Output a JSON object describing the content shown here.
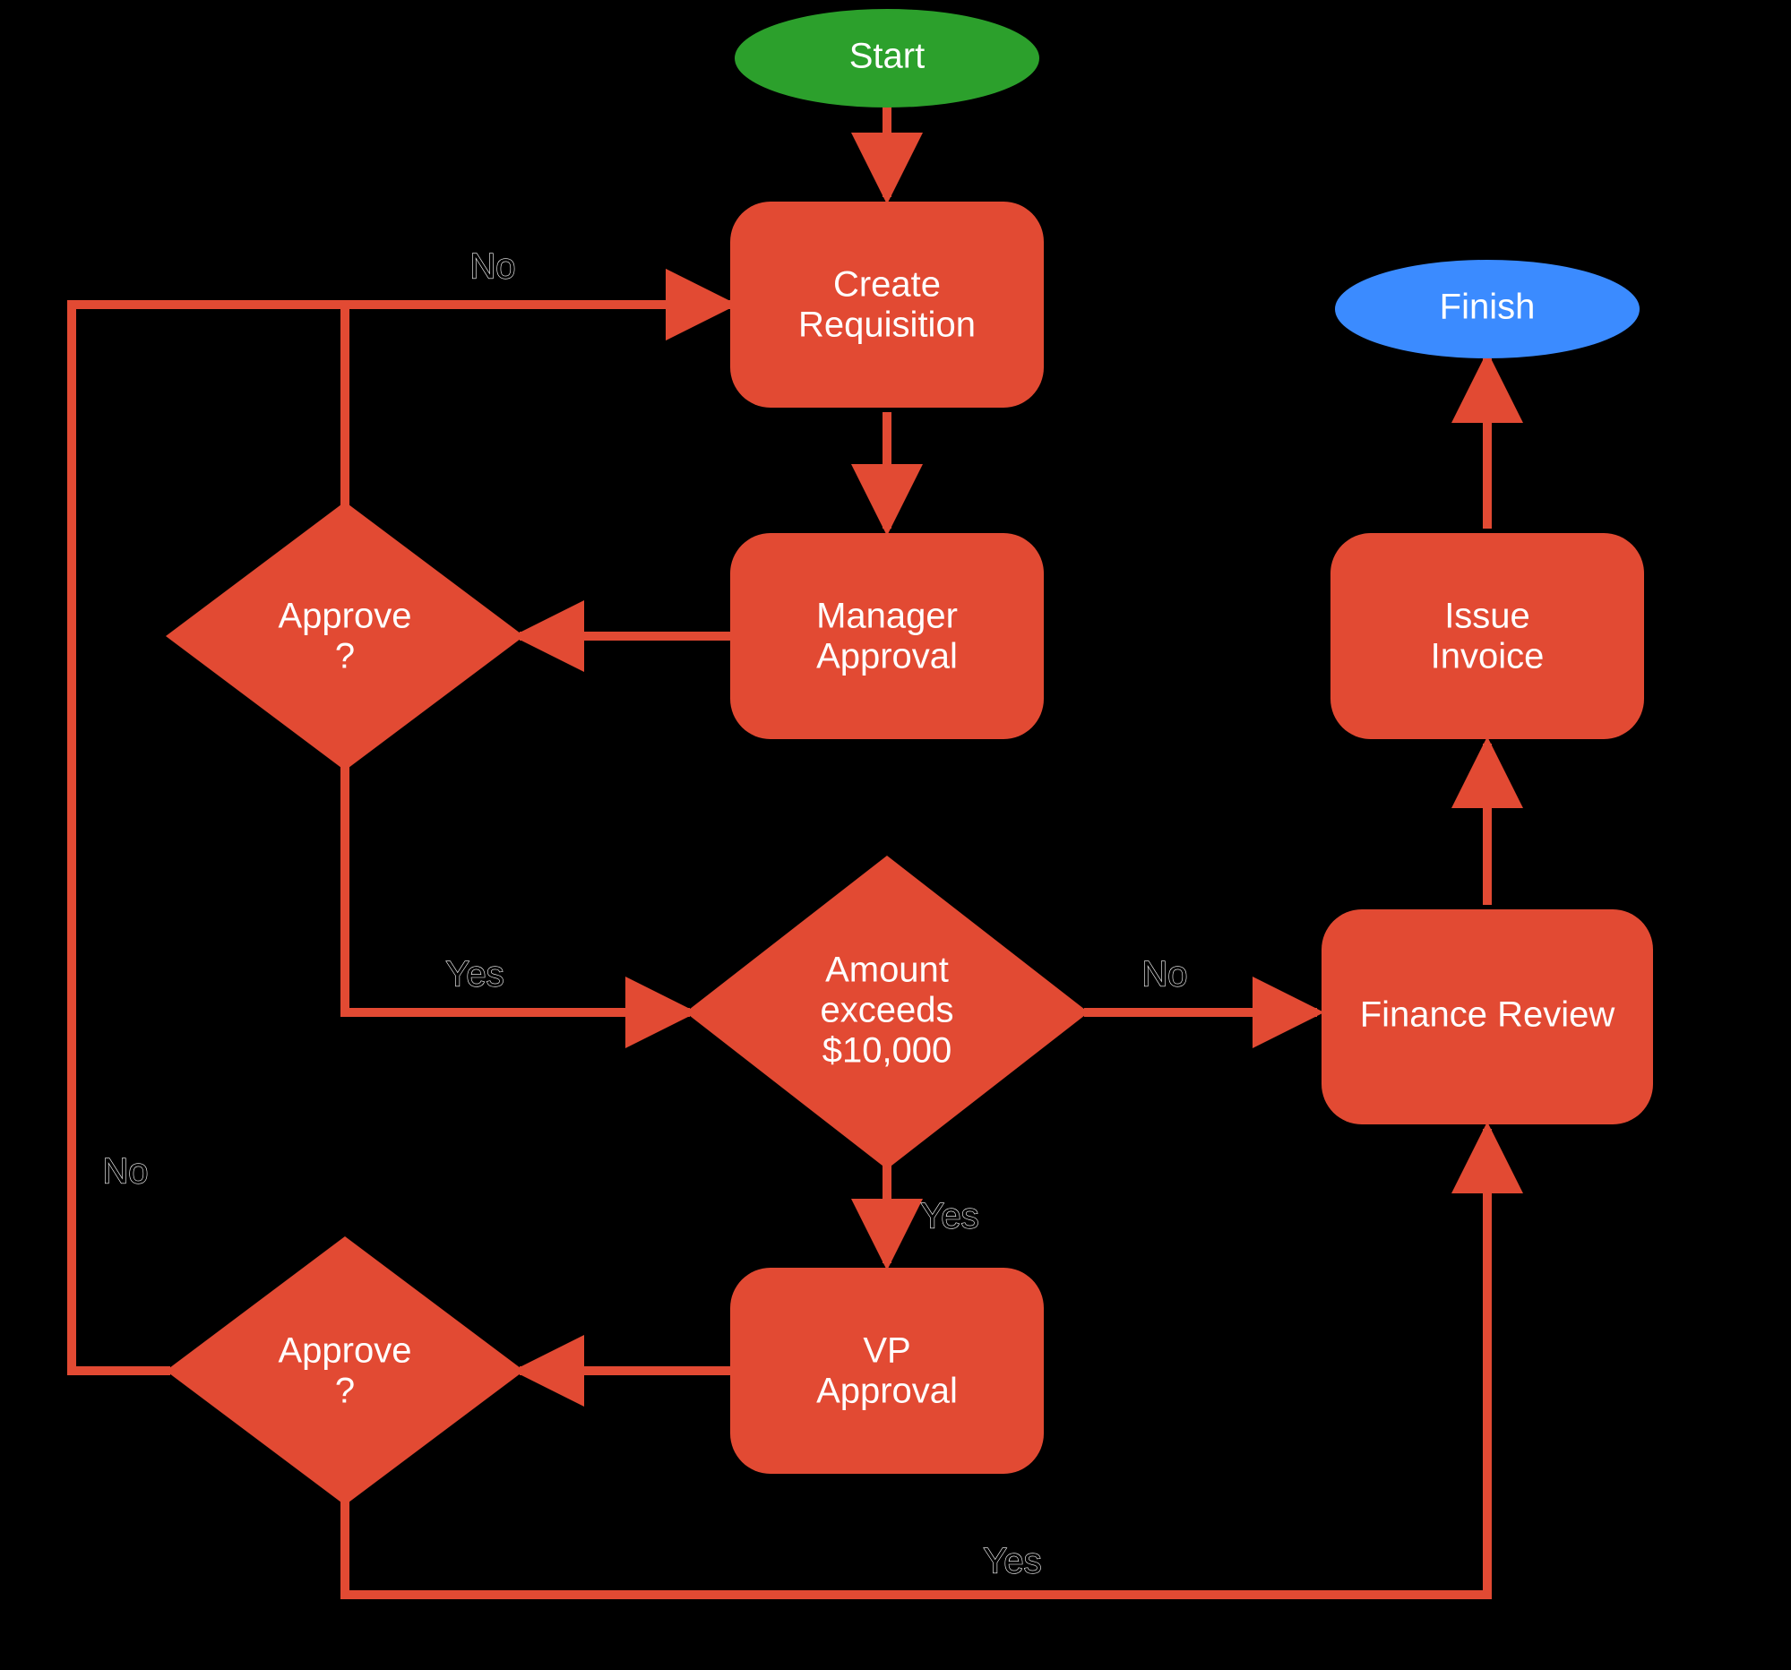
{
  "colors": {
    "start": "#2ca02c",
    "finish": "#3b8bff",
    "node": "#e24a33",
    "edge": "#e24a33"
  },
  "nodes": {
    "start": {
      "label": "Start"
    },
    "createRequisition": {
      "label1": "Create",
      "label2": "Requisition"
    },
    "managerApproval": {
      "label1": "Manager",
      "label2": "Approval"
    },
    "approve1": {
      "label1": "Approve",
      "label2": "?"
    },
    "amountExceeds": {
      "label1": "Amount",
      "label2": "exceeds",
      "label3": "$10,000"
    },
    "vpApproval": {
      "label1": "VP",
      "label2": "Approval"
    },
    "approve2": {
      "label1": "Approve",
      "label2": "?"
    },
    "financeReview": {
      "label": "Finance Review"
    },
    "issueInvoice": {
      "label1": "Issue",
      "label2": "Invoice"
    },
    "finish": {
      "label": "Finish"
    }
  },
  "edgeLabels": {
    "approve1_no": "No",
    "approve1_yes": "Yes",
    "amount_no": "No",
    "amount_yes": "Yes",
    "approve2_no": "No",
    "approve2_yes": "Yes"
  }
}
